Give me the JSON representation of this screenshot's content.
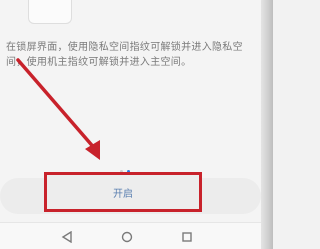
{
  "description": "在锁屏界面，使用隐私空间指纹可解锁并进入隐私空间，使用机主指纹可解锁并进入主空间。",
  "primary_button": {
    "label": "开启"
  },
  "pagination": {
    "current_page": 2,
    "total_pages": 2
  },
  "annotation": {
    "color": "#c8222b"
  },
  "navigation": {
    "back_icon": "triangle-back-icon",
    "home_icon": "circle-home-icon",
    "recents_icon": "square-recents-icon"
  }
}
